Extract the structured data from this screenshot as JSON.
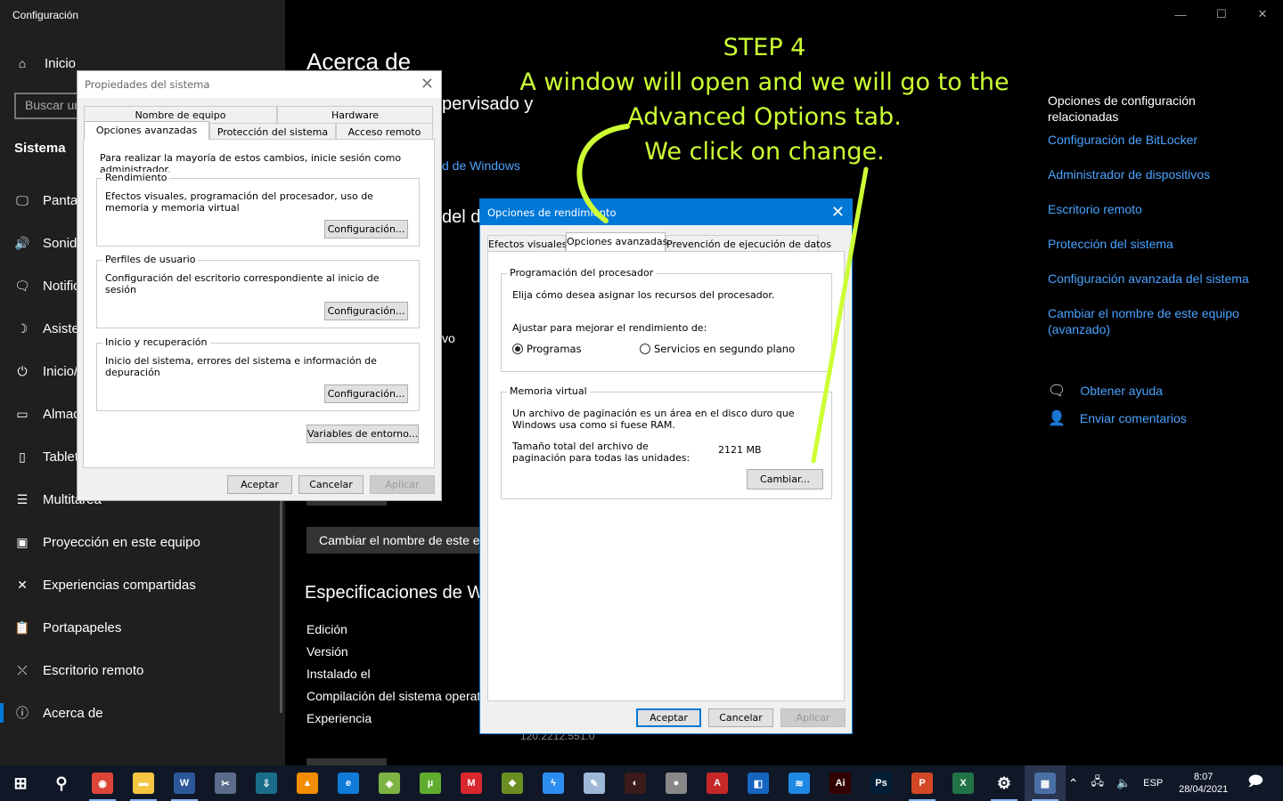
{
  "window": {
    "title": "Configuración",
    "controls": {
      "minimize": "—",
      "maximize": "☐",
      "close": "✕"
    }
  },
  "sidebar": {
    "home": "Inicio",
    "search_placeholder": "Buscar un",
    "section": "Sistema",
    "items": [
      {
        "label": "Pantalla",
        "icon": "monitor-icon",
        "glyph": "🖵"
      },
      {
        "label": "Sonido",
        "icon": "speaker-icon",
        "glyph": "🔊"
      },
      {
        "label": "Notificaciones",
        "icon": "notification-icon",
        "glyph": "🗨"
      },
      {
        "label": "Asistente",
        "icon": "moon-icon",
        "glyph": "☽"
      },
      {
        "label": "Inicio/apagado",
        "icon": "power-icon",
        "glyph": "⏻"
      },
      {
        "label": "Almacenamiento",
        "icon": "storage-icon",
        "glyph": "▭"
      },
      {
        "label": "Tableta",
        "icon": "tablet-icon",
        "glyph": "▯"
      },
      {
        "label": "Multitarea",
        "icon": "multitask-icon",
        "glyph": "☰"
      },
      {
        "label": "Proyección en este equipo",
        "icon": "projection-icon",
        "glyph": "▣"
      },
      {
        "label": "Experiencias compartidas",
        "icon": "share-icon",
        "glyph": "✕"
      },
      {
        "label": "Portapapeles",
        "icon": "clipboard-icon",
        "glyph": "📋"
      },
      {
        "label": "Escritorio remoto",
        "icon": "remote-desktop-icon",
        "glyph": "⤬"
      },
      {
        "label": "Acerca de",
        "icon": "info-icon",
        "glyph": "ⓘ"
      }
    ]
  },
  "main": {
    "title": "Acerca de",
    "line_supervisado": "pervisado y",
    "link_windows": "d de Windows",
    "heading_dispositivo": "del di",
    "text_vo": "vo",
    "rename_button": "Cambiar el nombre de este eq",
    "specs_heading": "Especificaciones de Wi",
    "specs": [
      "Edición",
      "Versión",
      "Instalado el",
      "Compilación del sistema operat",
      "Experiencia"
    ],
    "specs_tail": "120.2212.551.0"
  },
  "related": {
    "title": "Opciones de configuración relacionadas",
    "links": [
      "Configuración de BitLocker",
      "Administrador de dispositivos",
      "Escritorio remoto",
      "Protección del sistema",
      "Configuración avanzada del sistema",
      "Cambiar el nombre de este equipo (avanzado)"
    ],
    "help": "Obtener ayuda",
    "feedback": "Enviar comentarios"
  },
  "sysprops": {
    "title": "Propiedades del sistema",
    "tabs_row1": [
      "Nombre de equipo",
      "Hardware"
    ],
    "tabs_row2": [
      "Opciones avanzadas",
      "Protección del sistema",
      "Acceso remoto"
    ],
    "intro": "Para realizar la mayoría de estos cambios, inicie sesión como administrador.",
    "groups": [
      {
        "label": "Rendimiento",
        "text": "Efectos visuales, programación del procesador, uso de memoria y memoria virtual",
        "button": "Configuración..."
      },
      {
        "label": "Perfiles de usuario",
        "text": "Configuración del escritorio correspondiente al inicio de sesión",
        "button": "Configuración..."
      },
      {
        "label": "Inicio y recuperación",
        "text": "Inicio del sistema, errores del sistema e información de depuración",
        "button": "Configuración..."
      }
    ],
    "env_button": "Variables de entorno...",
    "ok": "Aceptar",
    "cancel": "Cancelar",
    "apply": "Aplicar"
  },
  "perf": {
    "title": "Opciones de rendimiento",
    "tabs": [
      "Efectos visuales",
      "Opciones avanzadas",
      "Prevención de ejecución de datos"
    ],
    "cpu_group": "Programación del procesador",
    "cpu_desc": "Elija cómo desea asignar los recursos del procesador.",
    "adjust_label": "Ajustar para mejorar el rendimiento de:",
    "radio_programs": "Programas",
    "radio_services": "Servicios en segundo plano",
    "vm_group": "Memoria virtual",
    "vm_desc": "Un archivo de paginación es un área en el disco duro que Windows usa como si fuese RAM.",
    "vm_total_label": "Tamaño total del archivo de paginación para todas las unidades:",
    "vm_total_value": "2121 MB",
    "change_button": "Cambiar...",
    "ok": "Aceptar",
    "cancel": "Cancelar",
    "apply": "Aplicar"
  },
  "annotation": {
    "lines": [
      "STEP 4",
      "A window will open and we will go to the",
      "Advanced Options tab.",
      "We click on change."
    ],
    "color": "#ccff33"
  },
  "taskbar": {
    "apps": [
      {
        "name": "start-icon",
        "glyph": "⊞",
        "bg": "transparent"
      },
      {
        "name": "search-icon",
        "glyph": "⚲",
        "bg": "transparent"
      },
      {
        "name": "chrome-icon",
        "glyph": "◉",
        "bg": "#db4437",
        "running": true
      },
      {
        "name": "file-explorer-icon",
        "glyph": "▬",
        "bg": "#f4c542",
        "running": true
      },
      {
        "name": "word-icon",
        "glyph": "W",
        "bg": "#2b579a",
        "running": true
      },
      {
        "name": "snipping-icon",
        "glyph": "✂",
        "bg": "#5b6b8a"
      },
      {
        "name": "installer-icon",
        "glyph": "⇩",
        "bg": "#1a6e8a"
      },
      {
        "name": "vlc-icon",
        "glyph": "▲",
        "bg": "#f28c00"
      },
      {
        "name": "edge-icon",
        "glyph": "e",
        "bg": "#0f7ad8"
      },
      {
        "name": "android-icon",
        "glyph": "◈",
        "bg": "#7cb342"
      },
      {
        "name": "utorrent-icon",
        "glyph": "µ",
        "bg": "#5fad2f"
      },
      {
        "name": "mega-icon",
        "glyph": "M",
        "bg": "#d9272e"
      },
      {
        "name": "winrar-icon",
        "glyph": "❖",
        "bg": "#6b8e23"
      },
      {
        "name": "messenger-icon",
        "glyph": "ϟ",
        "bg": "#2d8cf0"
      },
      {
        "name": "quill-icon",
        "glyph": "✎",
        "bg": "#9fb8d8"
      },
      {
        "name": "speedometer-icon",
        "glyph": "◐",
        "bg": "#3a1a1a"
      },
      {
        "name": "record-icon",
        "glyph": "●",
        "bg": "#888"
      },
      {
        "name": "autocad-icon",
        "glyph": "A",
        "bg": "#c62828"
      },
      {
        "name": "sketchup-icon",
        "glyph": "◧",
        "bg": "#1565c0"
      },
      {
        "name": "layers-icon",
        "glyph": "≋",
        "bg": "#1e88e5"
      },
      {
        "name": "illustrator-icon",
        "glyph": "Ai",
        "bg": "#330000"
      },
      {
        "name": "photoshop-icon",
        "glyph": "Ps",
        "bg": "#001e36"
      },
      {
        "name": "powerpoint-icon",
        "glyph": "P",
        "bg": "#d24726",
        "running": true
      },
      {
        "name": "excel-icon",
        "glyph": "X",
        "bg": "#217346"
      },
      {
        "name": "settings-icon",
        "glyph": "⚙",
        "bg": "transparent",
        "running": true
      },
      {
        "name": "system-properties-icon",
        "glyph": "▦",
        "bg": "#4a6fa5",
        "running": true,
        "active": true
      }
    ],
    "tray": {
      "chevron": "⌃",
      "network": "🖧",
      "volume": "🔈",
      "lang": "ESP",
      "time": "8:07",
      "date": "28/04/2021",
      "notifications": "🗩"
    }
  }
}
